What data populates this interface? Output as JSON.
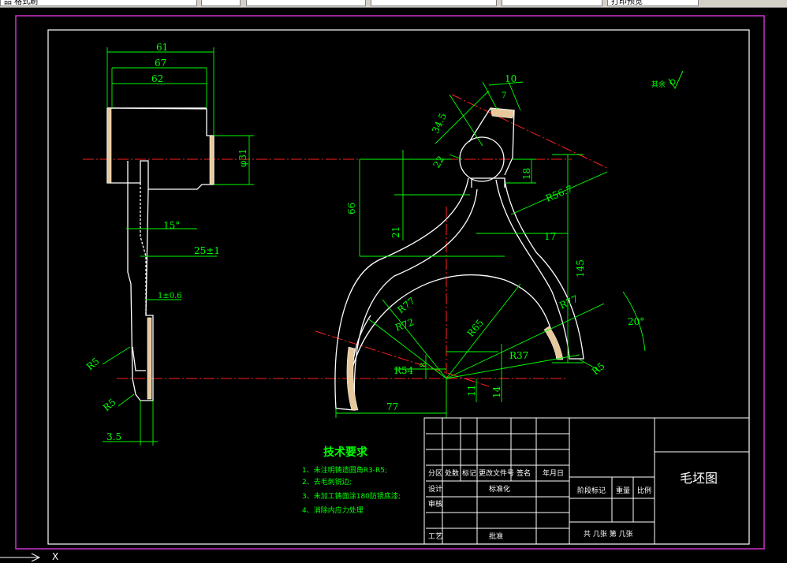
{
  "tabs": [
    "品 格式刷",
    "",
    "",
    "",
    "",
    "",
    "打印预览"
  ],
  "colors": {
    "background": "#000000",
    "geometry": "#ffffff",
    "dimension": "#00ff00",
    "centerline": "#ff2020",
    "frame": "#cc33cc",
    "hatch": "#e8c89a"
  },
  "dims": {
    "d61": "61",
    "d67": "67",
    "d62": "62",
    "d31": "φ31",
    "a15": "15°",
    "d25": "25±1",
    "d1": "1±0.6",
    "r5a": "R5",
    "r5b": "R5",
    "d35": "3.5",
    "d10": "10",
    "d7": "7",
    "d345": "34.5",
    "d22": "22",
    "d18": "18",
    "r567": "R56.7",
    "d66": "66",
    "d21": "21",
    "d17": "17",
    "d145": "145",
    "r77a": "R77",
    "r72": "R72",
    "r65": "R65",
    "r77b": "R77",
    "a20": "20°",
    "r37": "R37",
    "r54": "R54",
    "d8": "8",
    "d11": "11",
    "d14": "14",
    "d77": "77",
    "r5c": "R5",
    "roughness": "其余"
  },
  "notes": {
    "title": "技术要求",
    "items": [
      "1、未注明铸造圆角R3-R5;",
      "2、去毛刺锐边;",
      "3、未加工铸面涂180防锈底漆;",
      "4、消除内应力处理"
    ]
  },
  "titleblock": {
    "headers": [
      "分区",
      "处数",
      "标记",
      "更改文件号",
      "签名",
      "年月日"
    ],
    "design": "设计",
    "standard": "标准化",
    "review": "审核",
    "process": "工艺",
    "approve": "批准",
    "stage": "阶段标记",
    "weight": "重量",
    "scale": "比例",
    "sheets": "共  几张  第  几张",
    "drawing_name": "毛坯图"
  },
  "cmdline": "X"
}
